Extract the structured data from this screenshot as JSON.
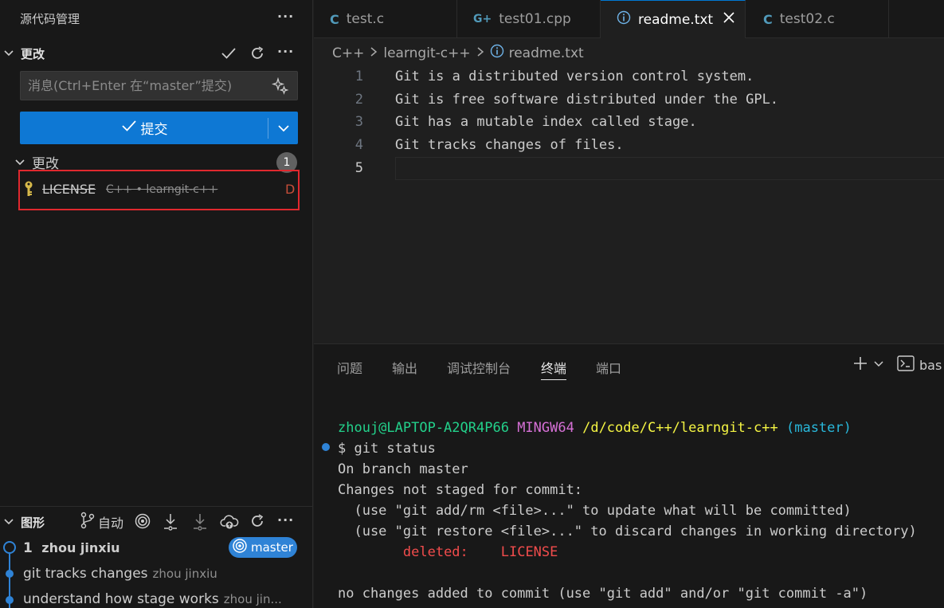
{
  "sidebar": {
    "title": "源代码管理",
    "more_label": "···",
    "changes_section_title": "更改",
    "message_placeholder": "消息(Ctrl+Enter 在“master”提交)",
    "commit_button_label": "提交",
    "changes_group_label": "更改",
    "changes_count": "1",
    "files": [
      {
        "name": "LICENSE",
        "path": "C++ • learngit-c++",
        "status": "D",
        "status_color": "#c74e39"
      }
    ]
  },
  "graph": {
    "title": "图形",
    "auto_label": "自动",
    "commits": [
      {
        "count": "1",
        "message": "",
        "author": "zhou jinxiu",
        "branch": "master"
      },
      {
        "message": "git tracks changes",
        "author": "zhou jinxiu"
      },
      {
        "message": "understand how stage works",
        "author": "zhou jin..."
      }
    ]
  },
  "tabs": [
    {
      "label": "test.c",
      "icon": "C",
      "icon_color": "#519aba",
      "active": false
    },
    {
      "label": "test01.cpp",
      "icon": "G+",
      "icon_color": "#519aba",
      "active": false
    },
    {
      "label": "readme.txt",
      "icon": "info-icon",
      "icon_color": "#6fb3e8",
      "active": true
    },
    {
      "label": "test02.c",
      "icon": "C",
      "icon_color": "#519aba",
      "active": false
    }
  ],
  "breadcrumb": {
    "items": [
      "C++",
      "learngit-c++",
      "readme.txt"
    ]
  },
  "editor": {
    "lines": [
      {
        "num": "1",
        "text": "Git is a distributed version control system."
      },
      {
        "num": "2",
        "text": "Git is free software distributed under the GPL."
      },
      {
        "num": "3",
        "text": "Git has a mutable index called stage."
      },
      {
        "num": "4",
        "text": "Git tracks changes of files."
      },
      {
        "num": "5",
        "text": ""
      }
    ]
  },
  "panel": {
    "tabs": [
      "问题",
      "输出",
      "调试控制台",
      "终端",
      "端口"
    ],
    "active_tab": "终端",
    "shell_label": "bas"
  },
  "terminal": {
    "prompt_user": "zhouj@LAPTOP-A2QR4P66",
    "prompt_env": "MINGW64",
    "prompt_path": "/d/code/C++/learngit-c++",
    "prompt_branch": "(master)",
    "command": "$ git status",
    "output": [
      "On branch master",
      "Changes not staged for commit:",
      "  (use \"git add/rm <file>...\" to update what will be committed)",
      "  (use \"git restore <file>...\" to discard changes in working directory)"
    ],
    "deleted_label": "deleted:",
    "deleted_file": "LICENSE",
    "final_line": "no changes added to commit (use \"git add\" and/or \"git commit -a\")"
  },
  "colors": {
    "accent": "#0e78d4",
    "highlight_border": "#e0282e"
  }
}
